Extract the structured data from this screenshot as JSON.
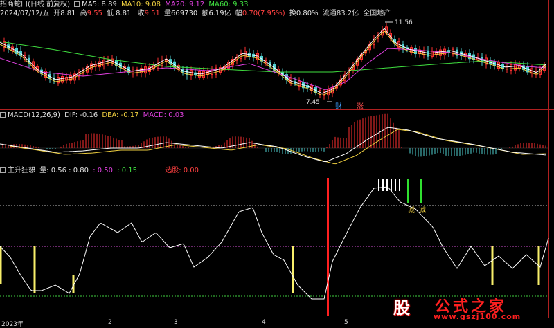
{
  "header": {
    "stock_name": "招商蛇口(日线 前复权)",
    "ma5": "MA5: 8.89",
    "ma10": "MA10: 9.08",
    "ma20": "MA20: 9.12",
    "ma60": "MA60: 9.33"
  },
  "info_line": {
    "date": "2024/07/12/五",
    "open": "开8.81",
    "high_label": "高",
    "high_value": "9.55",
    "low_label": "低",
    "low_value": "8.81",
    "close_label": "收",
    "close_value": "9.51",
    "volume": "量669730",
    "amount": "额6.19亿",
    "change_label": "幅",
    "change_value": "0.70(7.95%)",
    "turnover": "换0.80%",
    "float": "流通83.2亿",
    "sector": "全国地产"
  },
  "price_panel": {
    "max_label": "11.56",
    "min_label": "7.45",
    "event_cai": "财",
    "event_zhang": "涨"
  },
  "macd_panel": {
    "title": "MACD(12,26,9)",
    "dif": "DIF: -0.16",
    "dea": "DEA: -0.17",
    "macd": "MACD: 0.03"
  },
  "indicator_panel": {
    "title": "主升狂想",
    "liang_label": "量: 0.56 : 0.80",
    "value_050": ": 0.50",
    "value_015": ": 0.15",
    "xuangu": "选股: 0.00",
    "jian_1": "减",
    "jian_2": "减"
  },
  "x_axis": {
    "year": "2023年",
    "months": [
      "2",
      "3",
      "4",
      "5"
    ]
  },
  "watermark": {
    "logo": "股",
    "title": "公式之家",
    "url": "www.gszj100.com"
  },
  "colors": {
    "up": "#ff3030",
    "down": "#50d0d0",
    "ma5": "#ffffff",
    "ma10": "#f0d040",
    "ma20": "#e040e0",
    "ma60": "#40e040",
    "signal_yellow": "#f8ef6a",
    "signal_red": "#ff2020",
    "signal_white": "#ffffff",
    "signal_green": "#30e030"
  }
}
